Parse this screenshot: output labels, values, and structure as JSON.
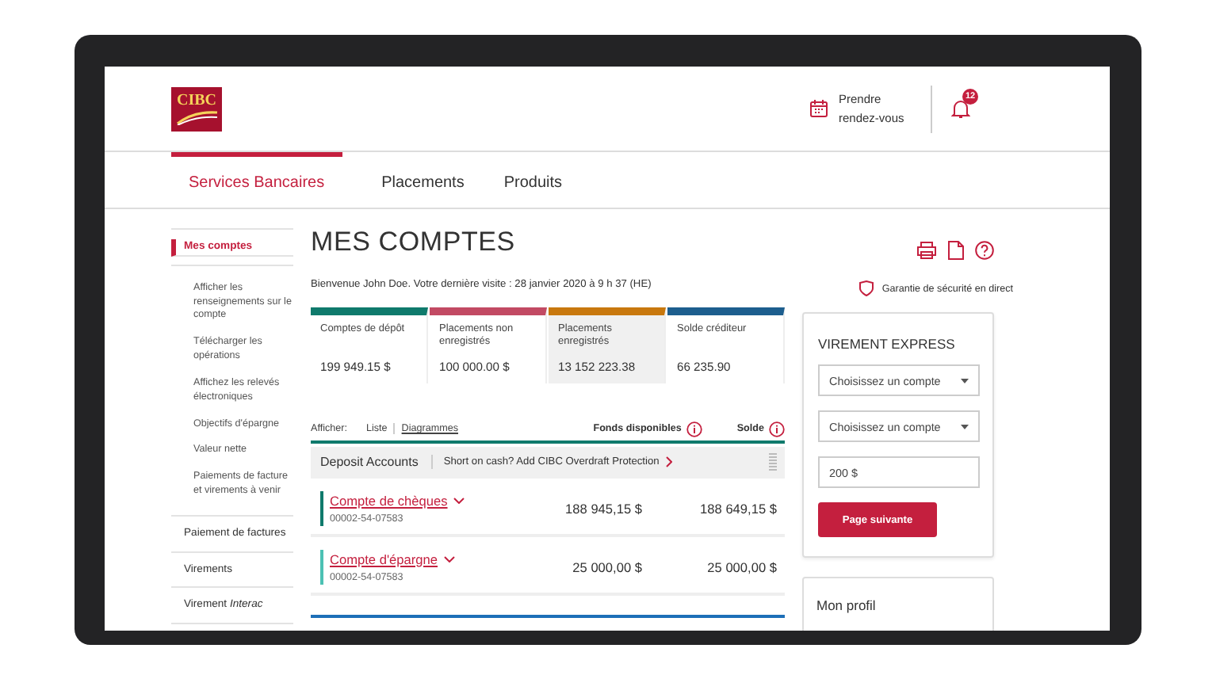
{
  "header": {
    "logo": "CIBC",
    "appointment": "Prendre rendez-vous",
    "notification_count": "12"
  },
  "nav": {
    "tabs": [
      {
        "label": "Services Bancaires",
        "selected": true
      },
      {
        "label": "Placements",
        "selected": false
      },
      {
        "label": "Produits",
        "selected": false
      }
    ]
  },
  "sidebar": {
    "items": [
      {
        "label": "Mes comptes",
        "selected": true,
        "children": [
          {
            "label": "Afficher les renseignements sur le compte"
          },
          {
            "label": "Télécharger les opérations"
          },
          {
            "label": "Affichez les relevés électroniques"
          },
          {
            "label": "Objectifs d'épargne"
          },
          {
            "label": "Valeur nette"
          },
          {
            "label": "Paiements de facture et virements à venir"
          }
        ]
      },
      {
        "label": "Paiement de factures",
        "selected": false
      },
      {
        "label": "Virements",
        "selected": false
      },
      {
        "label": "Virement *Interac*",
        "selected": false
      }
    ]
  },
  "main": {
    "title": "MES COMPTES",
    "welcome": "Bienvenue John Doe. Votre dernière visite : 28 janvier 2020 à 9 h 37 (HE)",
    "summary_cards": [
      {
        "label": "Comptes de dépôt",
        "amount": "199 949.15 $",
        "color": "#0f7a6c",
        "selected": false
      },
      {
        "label": "Placements non enregistrés",
        "amount": "100 000.00 $",
        "color": "#c24a63",
        "selected": false
      },
      {
        "label": "Placements enregistrés",
        "amount": "13 152 223.38",
        "color": "#c8780e",
        "selected": true
      },
      {
        "label": "Solde créditeur",
        "amount": "66 235.90",
        "color": "#1d5e8e",
        "selected": false
      }
    ],
    "view": {
      "label": "Afficher:",
      "options": [
        {
          "label": "Liste",
          "selected": true
        },
        {
          "label": "Diagrammes",
          "selected": false
        }
      ]
    },
    "columns": [
      "Fonds disponibles",
      "Solde"
    ],
    "group": {
      "title": "Deposit Accounts",
      "promo": "Short on cash? Add CIBC Overdraft Protection"
    },
    "accounts": [
      {
        "name": "Compte de chèques",
        "number": "00002-54-07583",
        "available": "188 945,15 $",
        "balance": "188 649,15 $",
        "color": "#0f7a6c"
      },
      {
        "name": "Compte d'épargne",
        "number": "00002-54-07583",
        "available": "25 000,00 $",
        "balance": "25 000,00 $",
        "color": "#4cc1b3"
      }
    ]
  },
  "security": "Garantie de sécurité en direct",
  "express": {
    "title": "VIREMENT EXPRESS",
    "from": {
      "placeholder": "Choisissez un compte"
    },
    "to": {
      "placeholder": "Choisissez un compte"
    },
    "amount": {
      "value": "200 $"
    },
    "button": "Page suivante"
  },
  "profile": {
    "title": "Mon profil"
  }
}
